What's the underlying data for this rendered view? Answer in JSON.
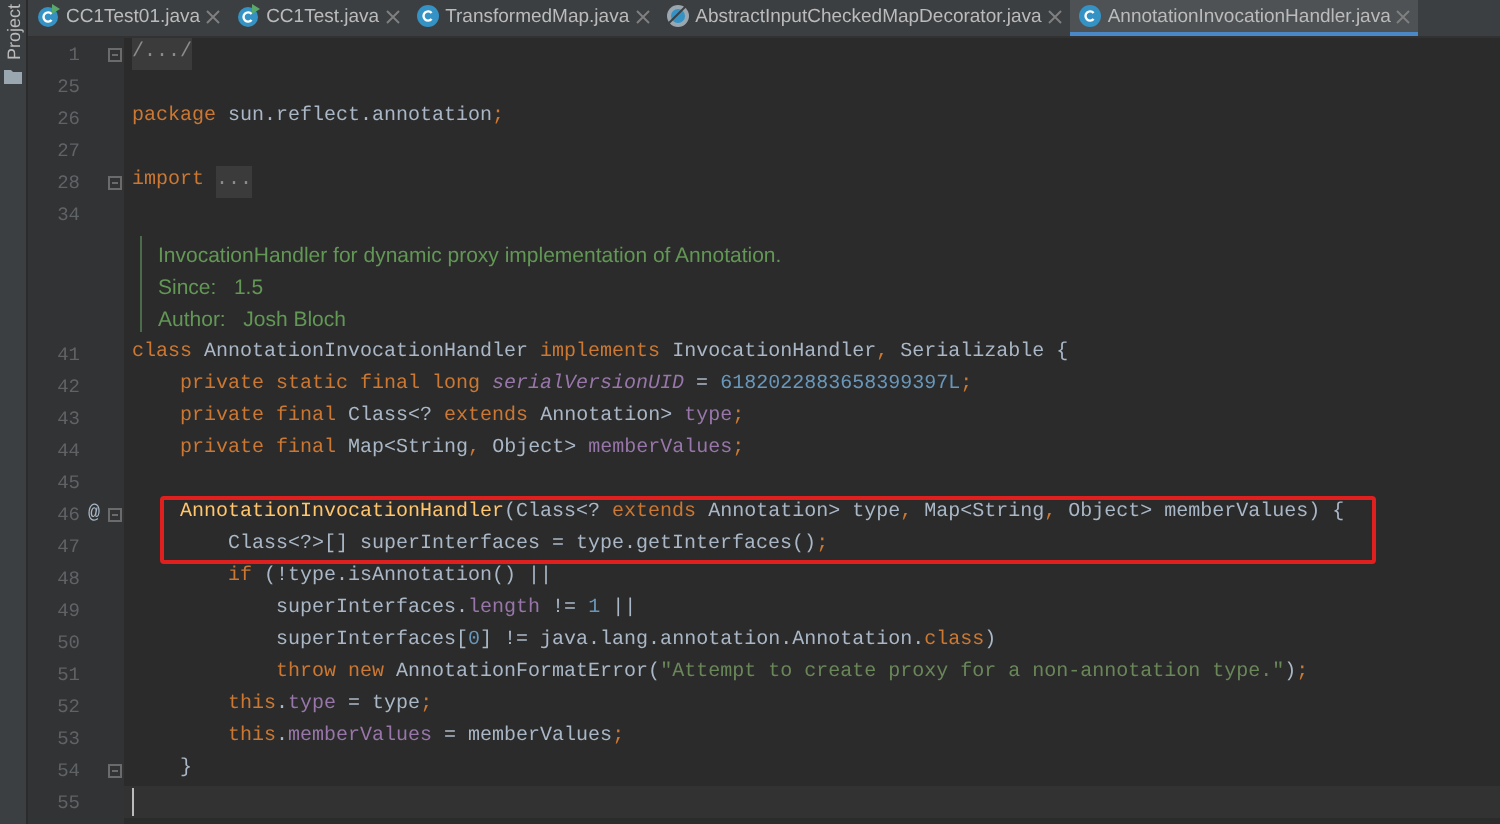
{
  "side_panel": {
    "label": "Project"
  },
  "tabs": [
    {
      "label": "CC1Test01.java",
      "kind": "runnable-class",
      "selected": false
    },
    {
      "label": "CC1Test.java",
      "kind": "runnable-class",
      "selected": false
    },
    {
      "label": "TransformedMap.java",
      "kind": "class",
      "selected": false
    },
    {
      "label": "AbstractInputCheckedMapDecorator.java",
      "kind": "abstract-class",
      "selected": false
    },
    {
      "label": "AnnotationInvocationHandler.java",
      "kind": "class",
      "selected": true
    }
  ],
  "editor": {
    "entries": [
      {
        "kind": "line",
        "number": "1",
        "fold": true,
        "tokens": [
          {
            "kind": "fold",
            "text": "/.../"
          }
        ]
      },
      {
        "kind": "line",
        "number": "25"
      },
      {
        "kind": "line",
        "number": "26",
        "tokens": [
          {
            "kind": "keyword",
            "text": "package "
          },
          {
            "kind": "plain",
            "text": "sun.reflect.annotation"
          },
          {
            "kind": "keyword",
            "text": ";"
          }
        ]
      },
      {
        "kind": "line",
        "number": "27"
      },
      {
        "kind": "line",
        "number": "28",
        "fold": true,
        "tokens": [
          {
            "kind": "keyword",
            "text": "import "
          },
          {
            "kind": "fold",
            "text": "..."
          }
        ]
      },
      {
        "kind": "line",
        "number": "34"
      },
      {
        "kind": "doc",
        "description": "InvocationHandler for dynamic proxy implementation of Annotation.",
        "tags": [
          {
            "label": "Since:",
            "value": "1.5"
          },
          {
            "label": "Author:",
            "value": "Josh Bloch"
          }
        ]
      },
      {
        "kind": "line",
        "number": "41",
        "tokens": [
          {
            "kind": "keyword",
            "text": "class "
          },
          {
            "kind": "plain",
            "text": "AnnotationInvocationHandler "
          },
          {
            "kind": "keyword",
            "text": "implements "
          },
          {
            "kind": "plain",
            "text": "InvocationHandler"
          },
          {
            "kind": "keyword",
            "text": ", "
          },
          {
            "kind": "plain",
            "text": "Serializable {"
          }
        ]
      },
      {
        "kind": "line",
        "number": "42",
        "tokens": [
          {
            "kind": "keyword",
            "text": "    private static final long "
          },
          {
            "kind": "static-field",
            "text": "serialVersionUID"
          },
          {
            "kind": "plain",
            "text": " = "
          },
          {
            "kind": "number",
            "text": "6182022883658399397L"
          },
          {
            "kind": "keyword",
            "text": ";"
          }
        ]
      },
      {
        "kind": "line",
        "number": "43",
        "tokens": [
          {
            "kind": "keyword",
            "text": "    private final "
          },
          {
            "kind": "plain",
            "text": "Class<? "
          },
          {
            "kind": "keyword",
            "text": "extends "
          },
          {
            "kind": "plain",
            "text": "Annotation> "
          },
          {
            "kind": "field",
            "text": "type"
          },
          {
            "kind": "keyword",
            "text": ";"
          }
        ]
      },
      {
        "kind": "line",
        "number": "44",
        "tokens": [
          {
            "kind": "keyword",
            "text": "    private final "
          },
          {
            "kind": "plain",
            "text": "Map<String"
          },
          {
            "kind": "keyword",
            "text": ", "
          },
          {
            "kind": "plain",
            "text": "Object> "
          },
          {
            "kind": "field",
            "text": "memberValues"
          },
          {
            "kind": "keyword",
            "text": ";"
          }
        ]
      },
      {
        "kind": "line",
        "number": "45"
      },
      {
        "kind": "line",
        "number": "46",
        "gutter_mark": "@",
        "fold": true,
        "highlighted": true,
        "tokens": [
          {
            "kind": "method",
            "text": "    AnnotationInvocationHandler"
          },
          {
            "kind": "plain",
            "text": "(Class<? "
          },
          {
            "kind": "keyword",
            "text": "extends "
          },
          {
            "kind": "plain",
            "text": "Annotation> type"
          },
          {
            "kind": "keyword",
            "text": ", "
          },
          {
            "kind": "plain",
            "text": "Map<String"
          },
          {
            "kind": "keyword",
            "text": ", "
          },
          {
            "kind": "plain",
            "text": "Object> memberValues) {"
          }
        ]
      },
      {
        "kind": "line",
        "number": "47",
        "highlighted": true,
        "tokens": [
          {
            "kind": "plain",
            "text": "        Class<?>[] superInterfaces = type.getInterfaces()"
          },
          {
            "kind": "keyword",
            "text": ";"
          }
        ]
      },
      {
        "kind": "line",
        "number": "48",
        "tokens": [
          {
            "kind": "keyword",
            "text": "        if "
          },
          {
            "kind": "plain",
            "text": "(!type.isAnnotation() ||"
          }
        ]
      },
      {
        "kind": "line",
        "number": "49",
        "tokens": [
          {
            "kind": "plain",
            "text": "            superInterfaces."
          },
          {
            "kind": "field",
            "text": "length"
          },
          {
            "kind": "plain",
            "text": " != "
          },
          {
            "kind": "number",
            "text": "1"
          },
          {
            "kind": "plain",
            "text": " ||"
          }
        ]
      },
      {
        "kind": "line",
        "number": "50",
        "tokens": [
          {
            "kind": "plain",
            "text": "            superInterfaces["
          },
          {
            "kind": "number",
            "text": "0"
          },
          {
            "kind": "plain",
            "text": "] != java.lang.annotation.Annotation."
          },
          {
            "kind": "keyword",
            "text": "class"
          },
          {
            "kind": "plain",
            "text": ")"
          }
        ]
      },
      {
        "kind": "line",
        "number": "51",
        "tokens": [
          {
            "kind": "keyword",
            "text": "            throw new "
          },
          {
            "kind": "plain",
            "text": "AnnotationFormatError("
          },
          {
            "kind": "string",
            "text": "\"Attempt to create proxy for a non-annotation type.\""
          },
          {
            "kind": "plain",
            "text": ")"
          },
          {
            "kind": "keyword",
            "text": ";"
          }
        ]
      },
      {
        "kind": "line",
        "number": "52",
        "tokens": [
          {
            "kind": "keyword",
            "text": "        this"
          },
          {
            "kind": "plain",
            "text": "."
          },
          {
            "kind": "field",
            "text": "type"
          },
          {
            "kind": "plain",
            "text": " = type"
          },
          {
            "kind": "keyword",
            "text": ";"
          }
        ]
      },
      {
        "kind": "line",
        "number": "53",
        "tokens": [
          {
            "kind": "keyword",
            "text": "        this"
          },
          {
            "kind": "plain",
            "text": "."
          },
          {
            "kind": "field",
            "text": "memberValues"
          },
          {
            "kind": "plain",
            "text": " = memberValues"
          },
          {
            "kind": "keyword",
            "text": ";"
          }
        ]
      },
      {
        "kind": "line",
        "number": "54",
        "fold": true,
        "tokens": [
          {
            "kind": "plain",
            "text": "    }"
          }
        ]
      },
      {
        "kind": "line",
        "number": "55",
        "caret": true
      }
    ]
  }
}
